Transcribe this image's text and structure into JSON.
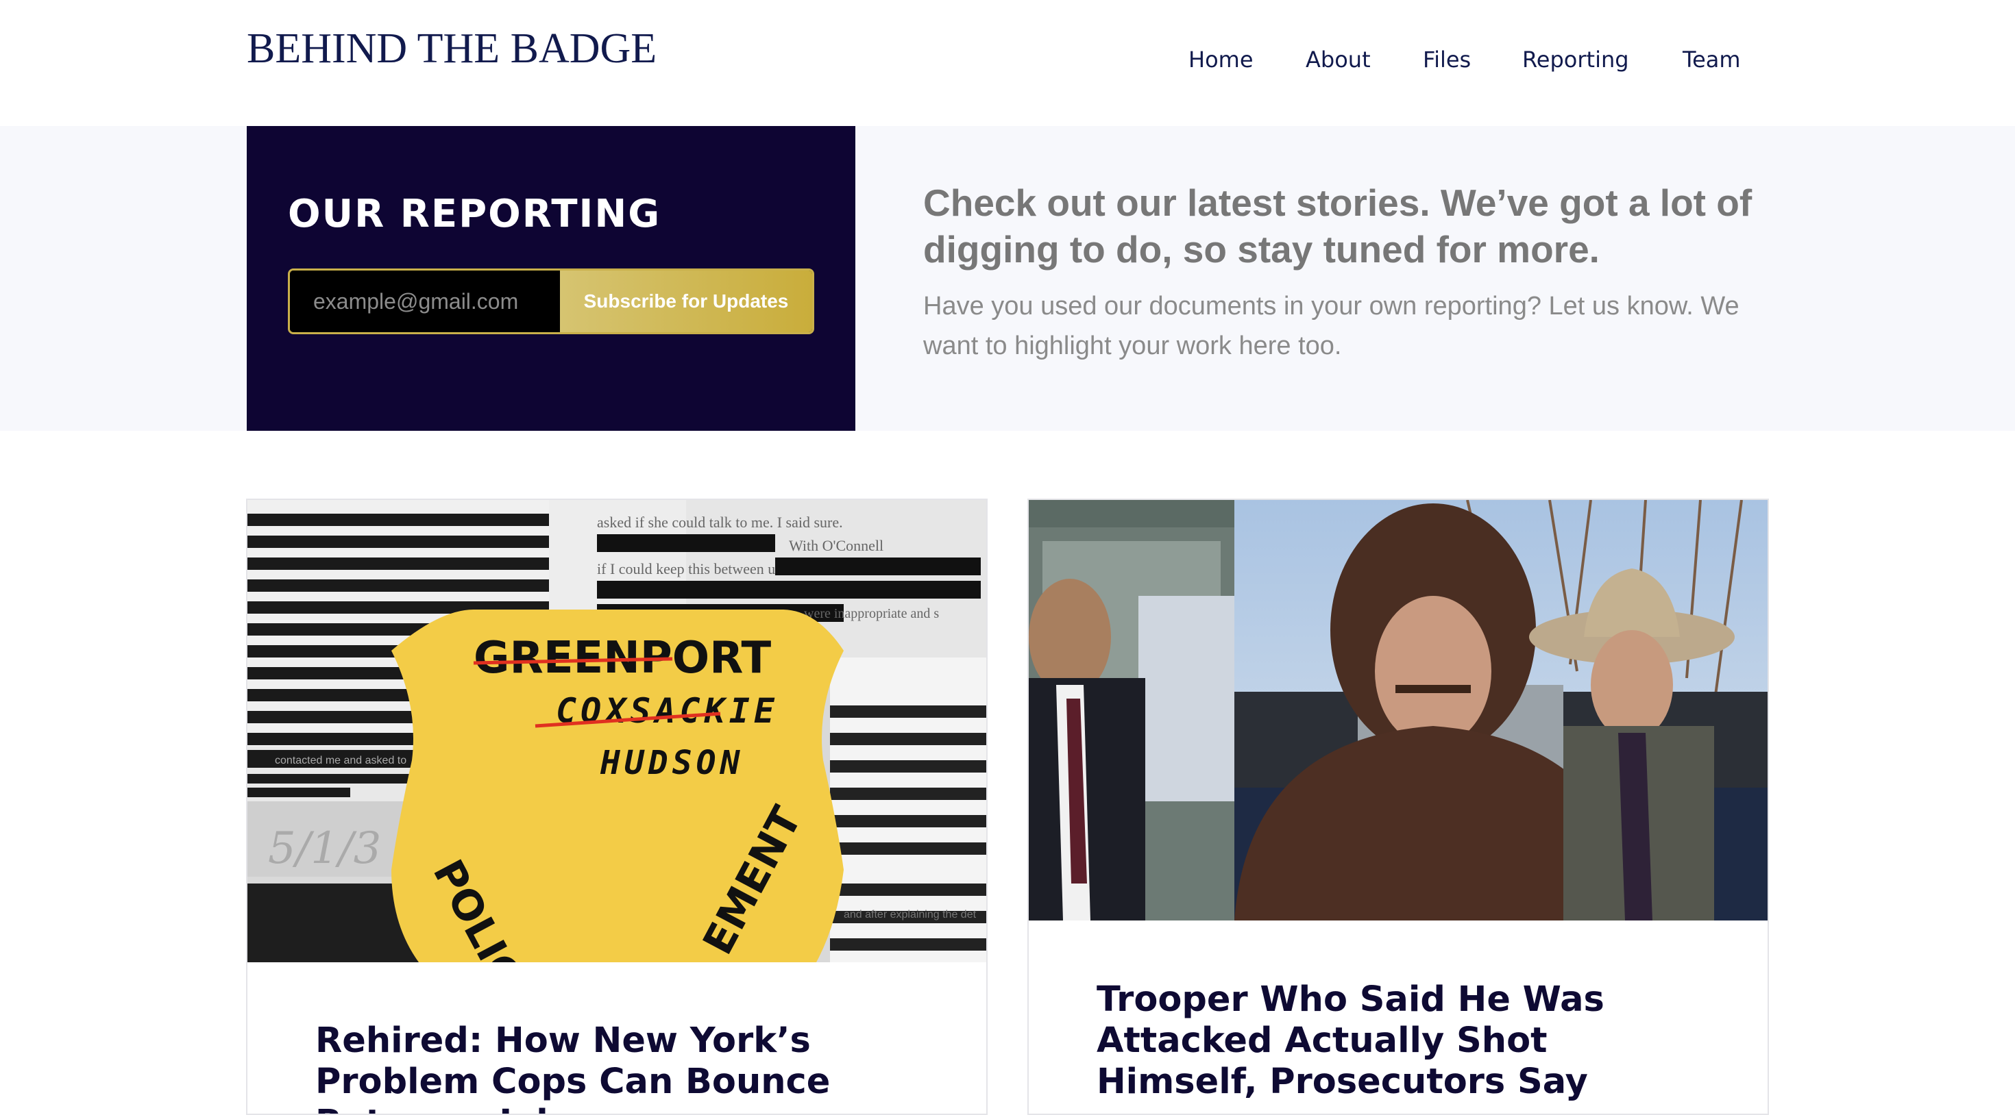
{
  "header": {
    "logo": "BEHIND THE BADGE",
    "nav": [
      {
        "label": "Home"
      },
      {
        "label": "About"
      },
      {
        "label": "Files"
      },
      {
        "label": "Reporting"
      },
      {
        "label": "Team"
      }
    ]
  },
  "signup": {
    "heading": "OUR REPORTING",
    "email_placeholder": "example@gmail.com",
    "button_label": "Subscribe for Updates"
  },
  "hero": {
    "lead": "Check out our latest stories. We’ve got a lot of digging to do, so stay tuned for more.",
    "sub": "Have you used our documents in your own reporting? Let us know. We want to highlight your work here too."
  },
  "cards": [
    {
      "title": "Rehired: How New York’s Problem Cops Can Bounce Between Jobs",
      "image": {
        "badge_lines": [
          "GREENPORT",
          "COXSACKIE",
          "HUDSON"
        ],
        "badge_arc_left": "POLIC",
        "badge_arc_right": "EMENT",
        "redacted_text": [
          "asked if she could talk to me. I said sure.",
          "With O'Connell",
          "if I could keep this between us",
          "were inappropriate and s",
          "contacted me and asked to",
          "and after explaining the det"
        ],
        "handwritten_date": "5/1/3"
      }
    },
    {
      "title": "Trooper Who Said He Was Attacked Actually Shot Himself, Prosecutors Say",
      "image": {
        "description_icon": "photo-icon"
      }
    }
  ],
  "colors": {
    "navy": "#0e0533",
    "gold": "#c9ad3b",
    "band": "#f7f8fc",
    "badge_yellow": "#f3cc47"
  }
}
